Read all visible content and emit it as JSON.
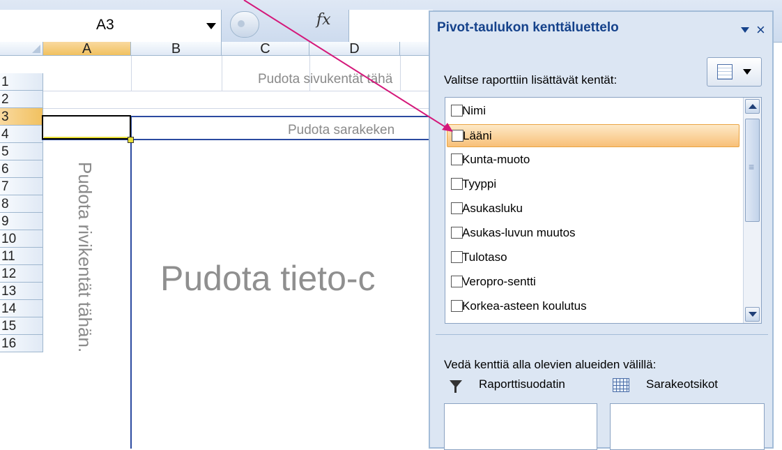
{
  "formula_bar": {
    "name_box": "A3",
    "fx_label": "fx"
  },
  "grid": {
    "columns": [
      "A",
      "B",
      "C",
      "D"
    ],
    "rows": [
      "1",
      "2",
      "3",
      "4",
      "5",
      "6",
      "7",
      "8",
      "9",
      "10",
      "11",
      "12",
      "13",
      "14",
      "15",
      "16"
    ],
    "selected_column": "A",
    "selected_row": "3",
    "drop_page_fields": "Pudota sivukentät tähä",
    "drop_column_fields": "Pudota sarakeken",
    "drop_row_fields": "Pudota rivikentät tähän.",
    "drop_data": "Pudota tieto-c"
  },
  "pivot_pane": {
    "title": "Pivot-taulukon kenttäluettelo",
    "fields_label": "Valitse raporttiin lisättävät kentät:",
    "fields": [
      {
        "label": "Nimi",
        "checked": false
      },
      {
        "label": "Lääni",
        "checked": false,
        "highlighted": true
      },
      {
        "label": "Kunta-muoto",
        "checked": false
      },
      {
        "label": "Tyyppi",
        "checked": false
      },
      {
        "label": "Asukasluku",
        "checked": false
      },
      {
        "label": "Asukas-luvun muutos",
        "checked": false
      },
      {
        "label": "Tulotaso",
        "checked": false
      },
      {
        "label": "Veropro-sentti",
        "checked": false
      },
      {
        "label": "Korkea-asteen koulutus",
        "checked": false
      }
    ],
    "drag_label": "Vedä kenttiä alla olevien alueiden välillä:",
    "filter_area_label": "Raporttisuodatin",
    "column_area_label": "Sarakeotsikot"
  },
  "colors": {
    "pivot_frame": "#2b4aa0",
    "pane_title": "#15428b",
    "annotation_arrow": "#d4187a",
    "selected_header": "#f1c15f"
  },
  "icons": [
    "chevron-down-icon",
    "formula-fx-icon",
    "pane-menu-arrow-icon",
    "close-icon",
    "field-layout-icon",
    "filter-icon",
    "column-headers-icon",
    "scroll-up-icon",
    "scroll-down-icon"
  ]
}
